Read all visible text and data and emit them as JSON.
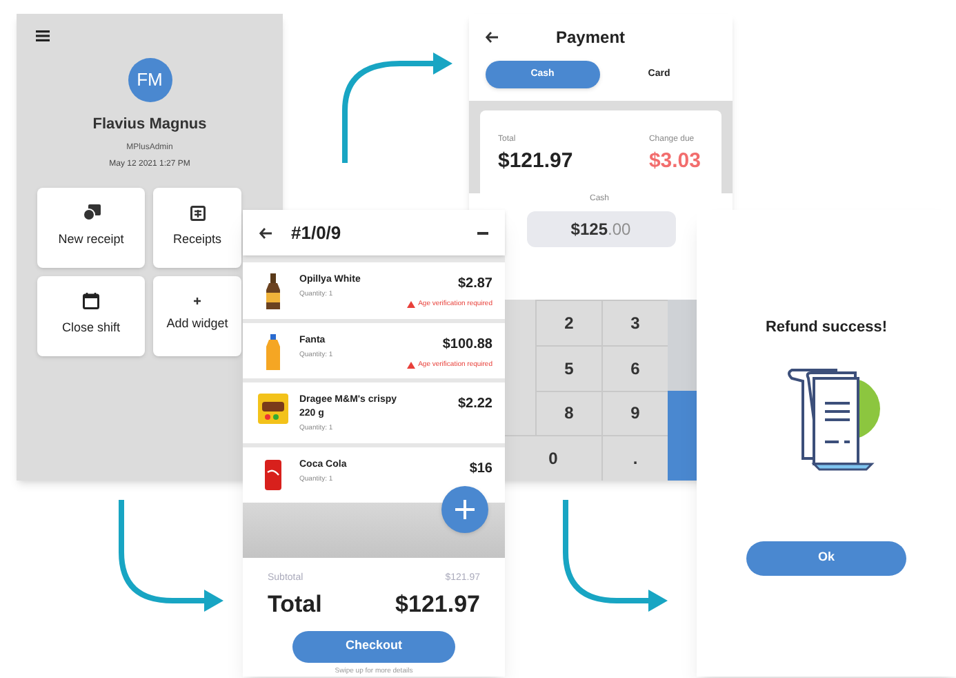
{
  "home": {
    "avatar_initials": "FM",
    "name": "Flavius Magnus",
    "role": "MPlusAdmin",
    "datetime": "May 12 2021 1:27 PM",
    "tiles": [
      {
        "kind": "receipt",
        "label": "New receipt"
      },
      {
        "kind": "list",
        "label": "Receipts"
      },
      {
        "kind": "calendar",
        "label": "Close shift"
      },
      {
        "kind": "plus",
        "label": "Add widget"
      }
    ]
  },
  "payment": {
    "title": "Payment",
    "tabs": [
      {
        "label": "Cash",
        "selected": true
      },
      {
        "label": "Card",
        "selected": false
      }
    ],
    "total_label": "Total",
    "total": "$121.97",
    "change_label": "Change due",
    "change": "$3.03",
    "cash_label": "Cash",
    "cash_amount": "$125",
    "cash_decimals": ".00",
    "keypad": [
      [
        "2",
        "3"
      ],
      [
        "5",
        "6"
      ],
      [
        "8",
        "9"
      ],
      [
        "0",
        "."
      ]
    ]
  },
  "receipt": {
    "title": "#1/0/9",
    "items": [
      {
        "kind": "beer",
        "name": "Opillya White",
        "quantity": "Quantity: 1",
        "price": "$2.87",
        "warning": "Age verification required"
      },
      {
        "kind": "soda",
        "name": "Fanta",
        "quantity": "Quantity: 1",
        "price": "$100.88",
        "warning": "Age verification required"
      },
      {
        "kind": "candy",
        "name": "Dragee M&M's crispy 220 g",
        "quantity": "Quantity: 1",
        "price": "$2.22"
      },
      {
        "kind": "can",
        "name": "Coca Cola",
        "quantity": "Quantity: 1",
        "price": "$16"
      }
    ],
    "subtotal_label": "Subtotal",
    "subtotal": "$121.97",
    "total_label": "Total",
    "total": "$121.97",
    "checkout": "Checkout",
    "hint": "Swipe up for more details"
  },
  "refund": {
    "title": "Refund success!",
    "button": "Ok"
  }
}
